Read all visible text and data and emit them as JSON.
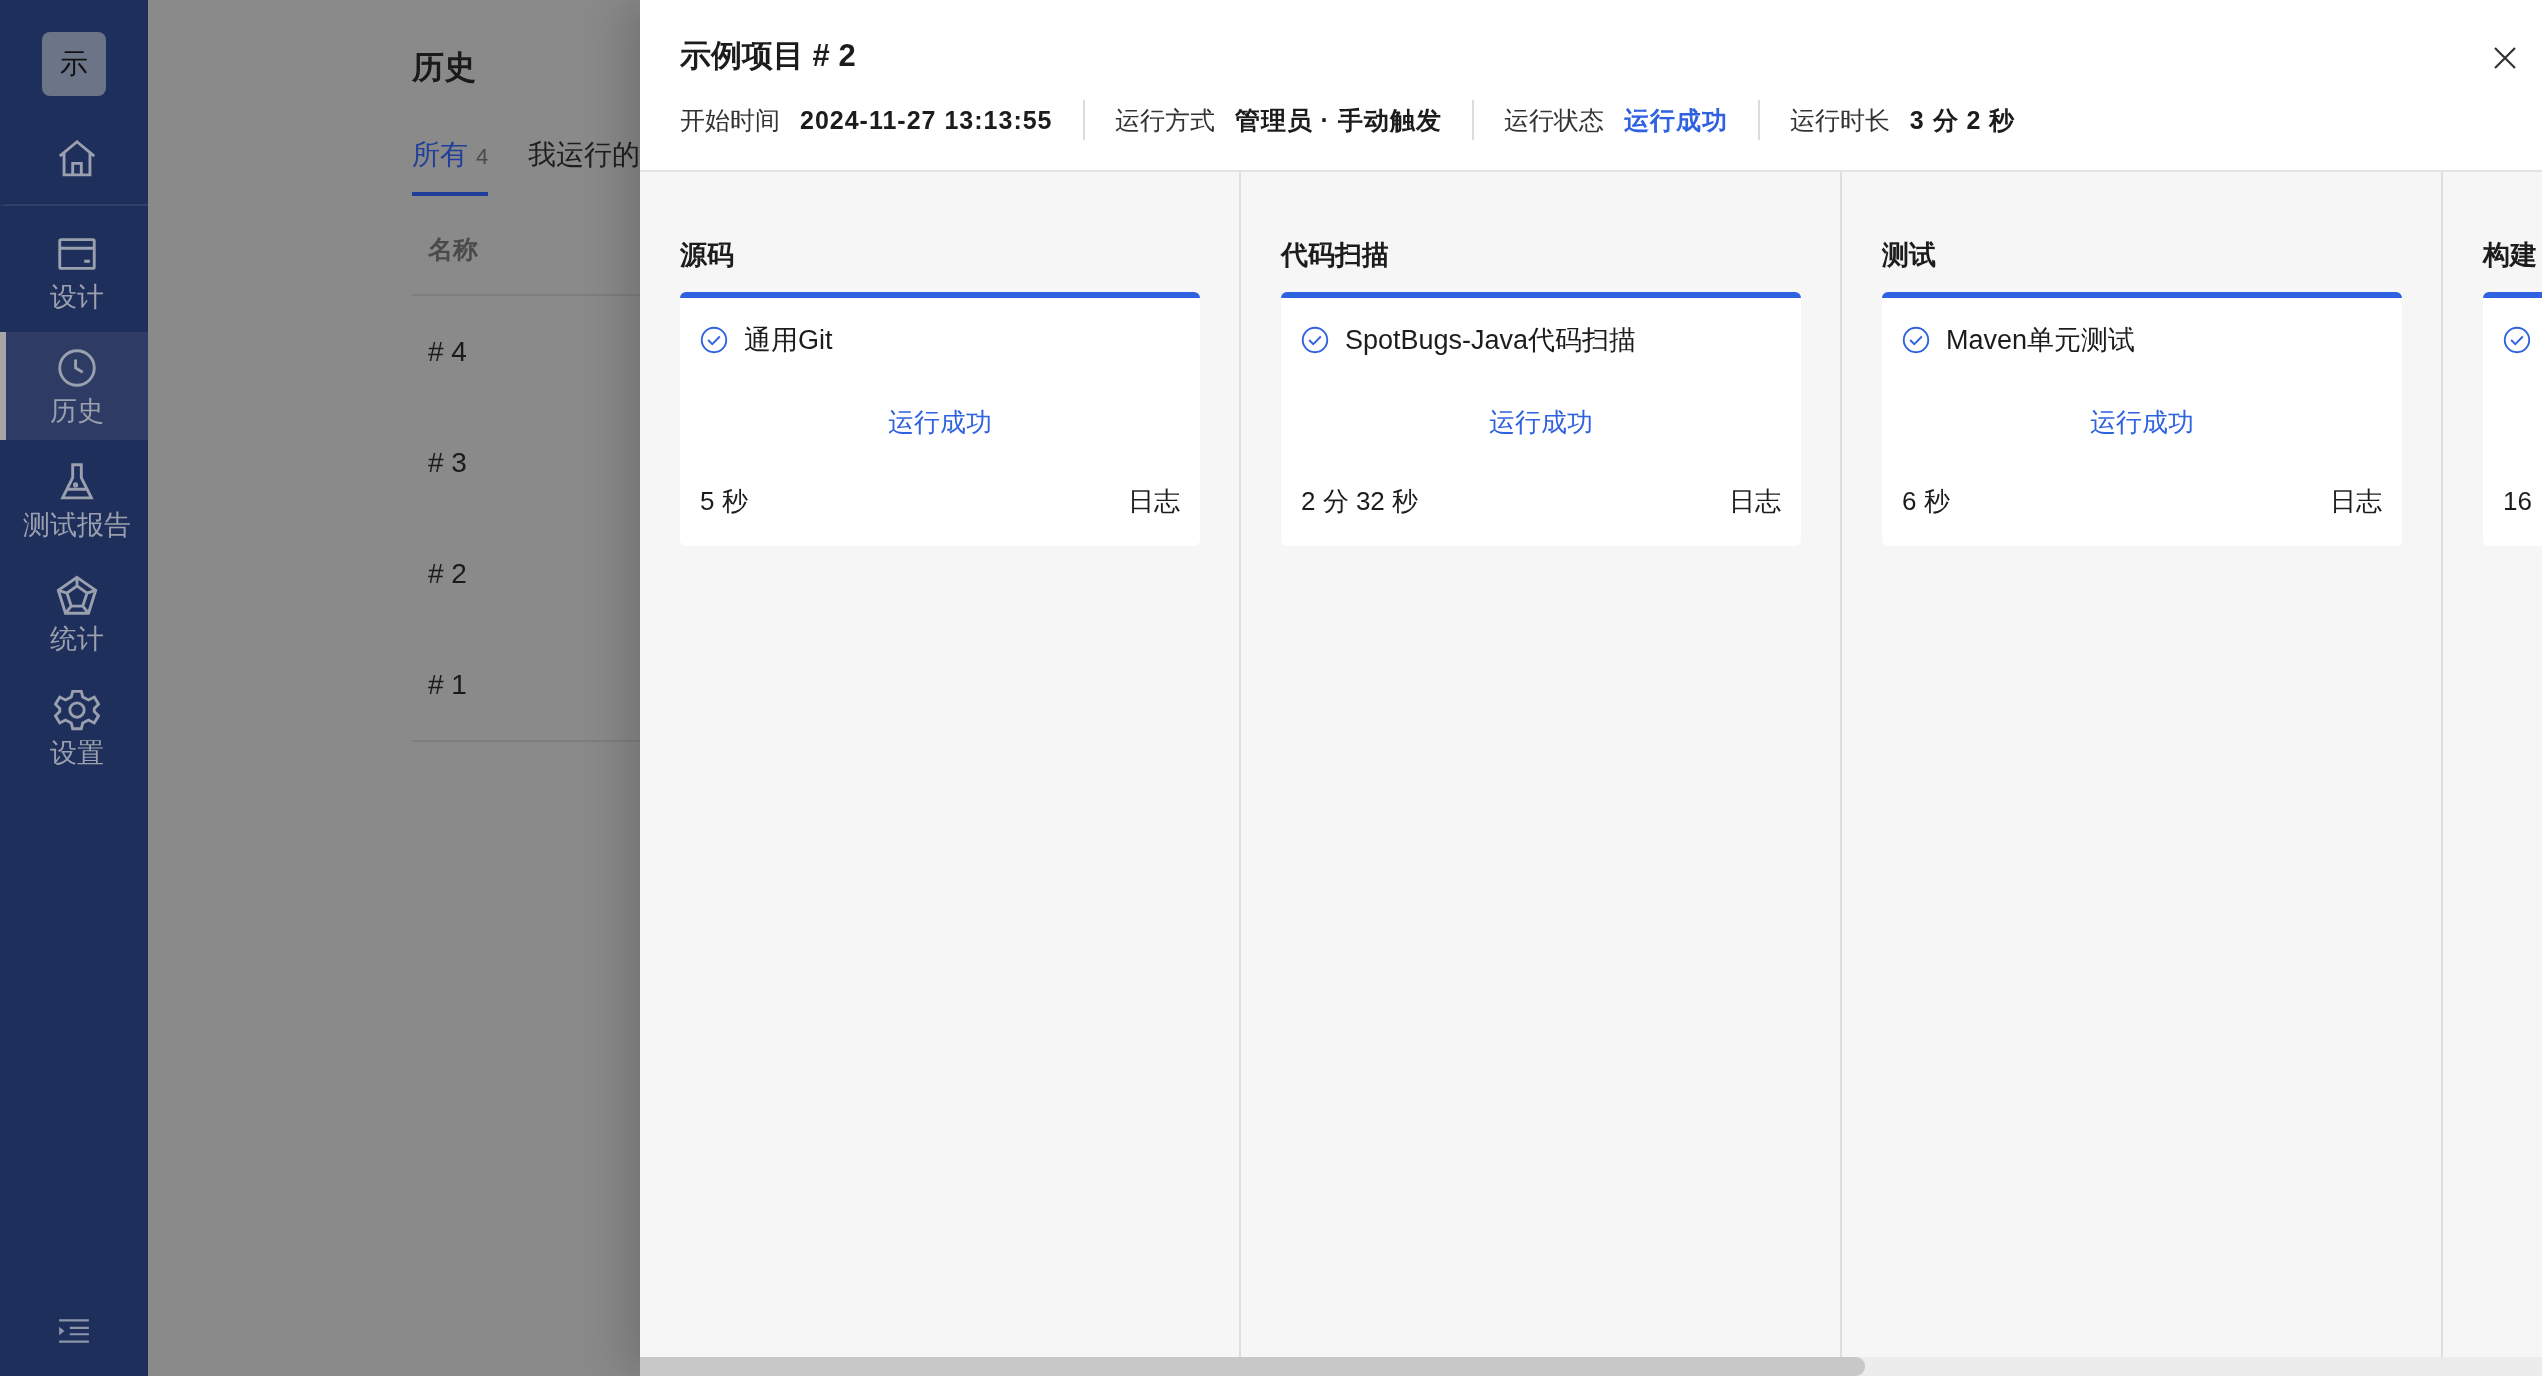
{
  "sidebar": {
    "logo": "示",
    "items": [
      {
        "kind": "home",
        "selected": false
      },
      {
        "kind": "design",
        "label": "设计",
        "selected": false
      },
      {
        "kind": "history",
        "label": "历史",
        "selected": true
      },
      {
        "kind": "report",
        "label": "测试报告",
        "selected": false
      },
      {
        "kind": "stats",
        "label": "统计",
        "selected": false
      },
      {
        "kind": "settings",
        "label": "设置",
        "selected": false
      }
    ]
  },
  "page": {
    "title": "历史",
    "tabs": [
      {
        "label": "所有",
        "count": "4",
        "selected": true
      },
      {
        "label": "我运行的",
        "selected": false
      }
    ],
    "table": {
      "columns": [
        "名称"
      ],
      "rows": [
        [
          "# 4"
        ],
        [
          "# 3"
        ],
        [
          "# 2"
        ],
        [
          "# 1"
        ]
      ]
    }
  },
  "drawer": {
    "title": "示例项目 # 2",
    "meta": [
      {
        "label": "开始时间",
        "value": "2024-11-27 13:13:55",
        "kind": "plain"
      },
      {
        "label": "运行方式",
        "value": "管理员 · 手动触发",
        "kind": "plain"
      },
      {
        "label": "运行状态",
        "value": "运行成功",
        "kind": "status"
      },
      {
        "label": "运行时长",
        "value": "3 分 2 秒",
        "kind": "plain"
      }
    ],
    "stages": [
      {
        "name": "源码",
        "jobs": [
          {
            "name": "通用Git",
            "succeeded": true,
            "status_text": "运行成功",
            "duration": "5 秒",
            "log": "日志"
          }
        ]
      },
      {
        "name": "代码扫描",
        "jobs": [
          {
            "name": "SpotBugs-Java代码扫描",
            "succeeded": true,
            "status_text": "运行成功",
            "duration": "2 分 32 秒",
            "log": "日志"
          }
        ]
      },
      {
        "name": "测试",
        "jobs": [
          {
            "name": "Maven单元测试",
            "succeeded": true,
            "status_text": "运行成功",
            "duration": "6 秒",
            "log": "日志"
          }
        ]
      },
      {
        "name": "构建",
        "jobs": [
          {
            "succeeded": true,
            "duration": "16"
          }
        ]
      }
    ]
  }
}
